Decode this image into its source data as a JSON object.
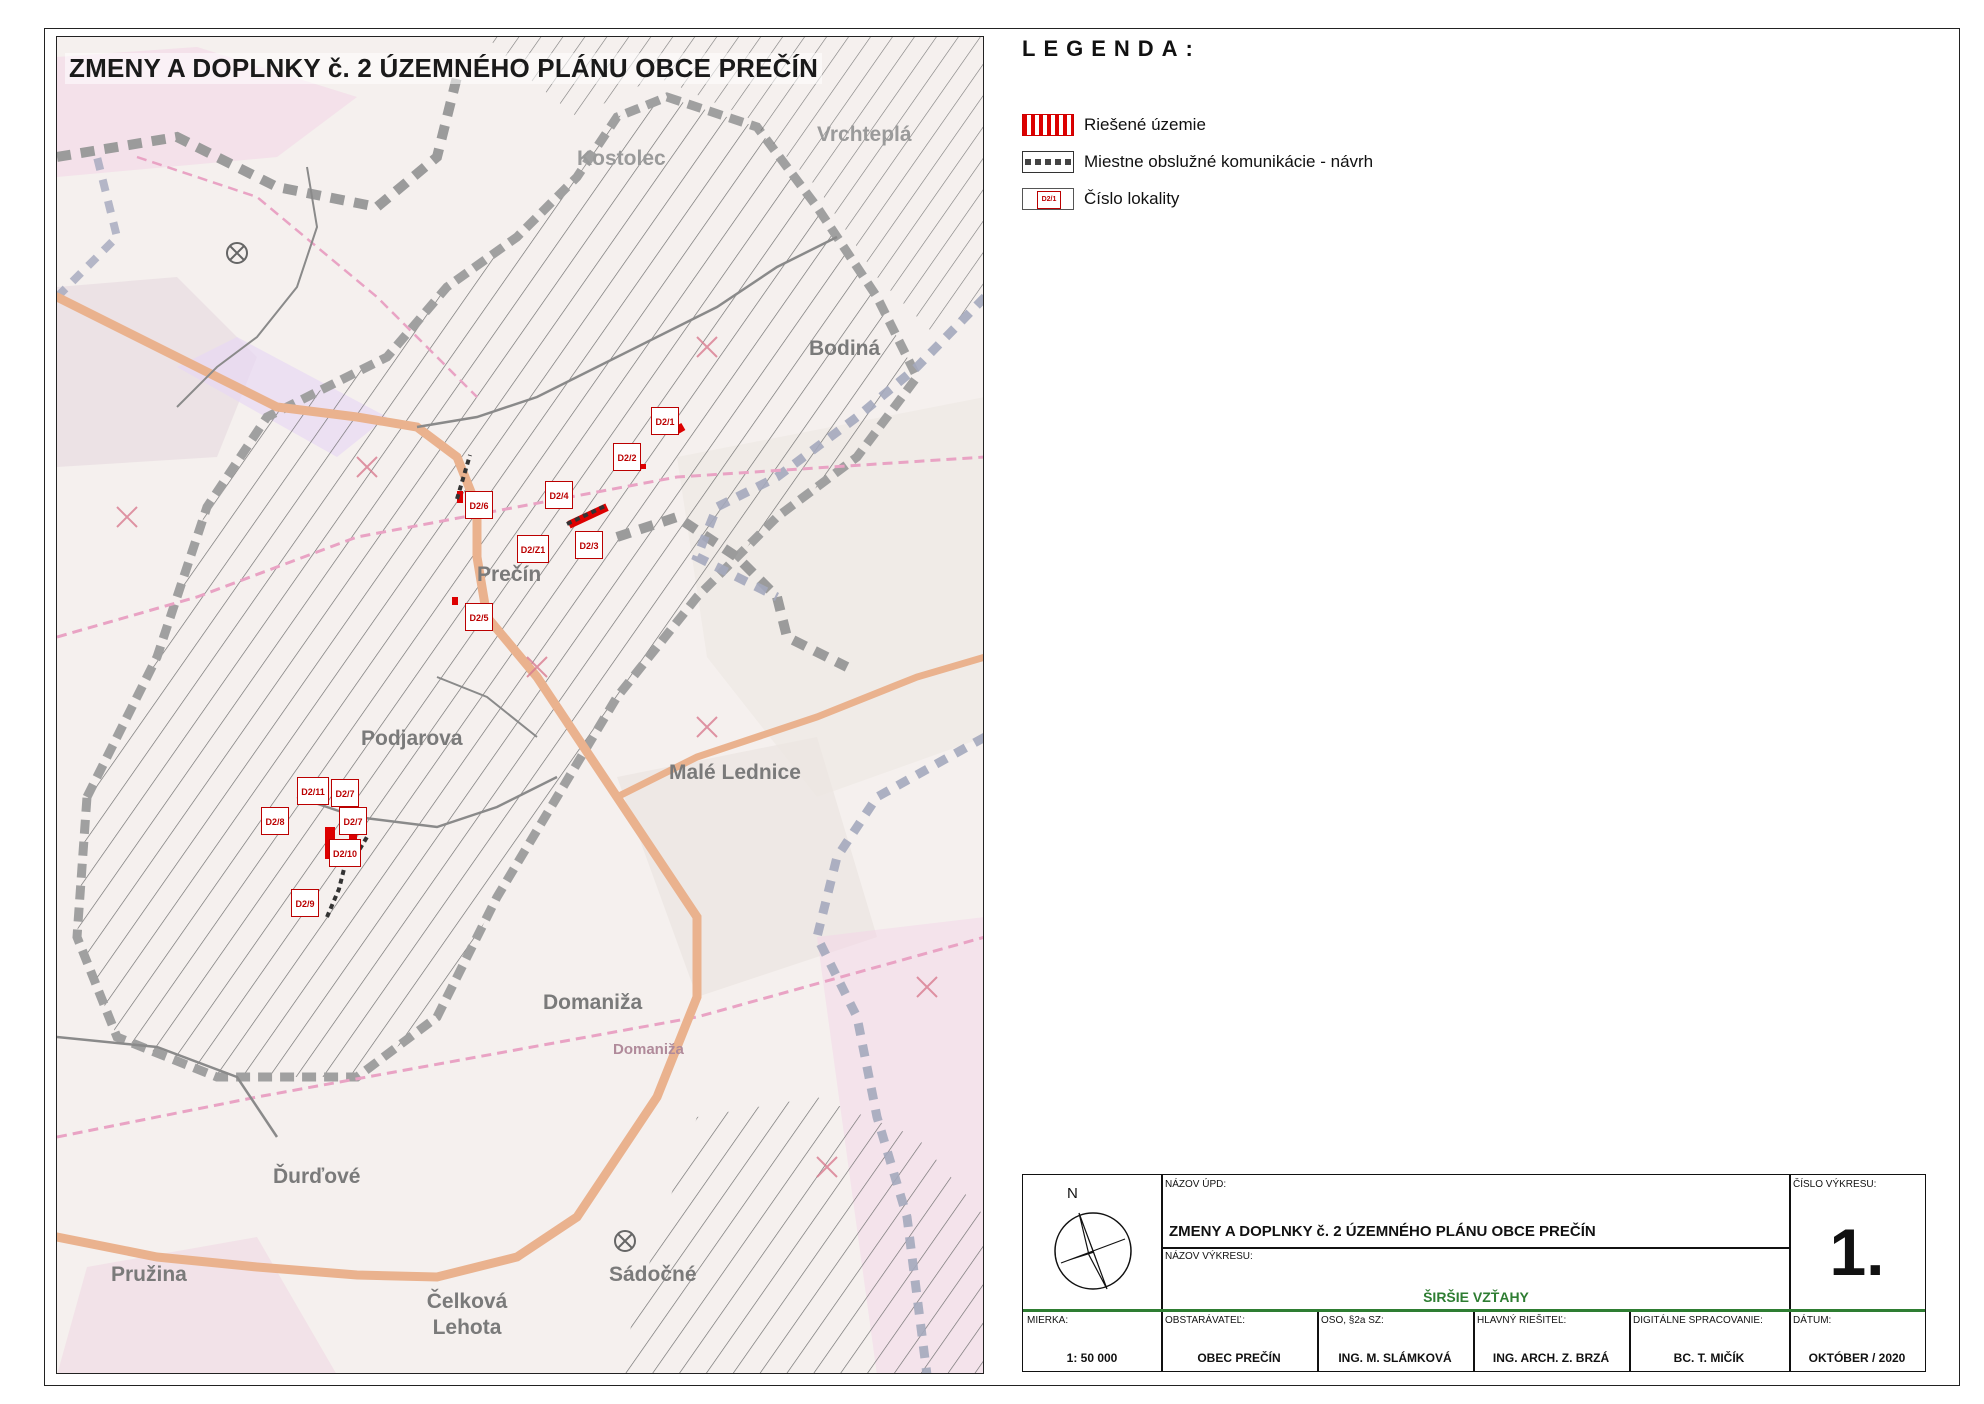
{
  "map": {
    "title": "ZMENY A DOPLNKY č. 2 ÚZEMNÉHO PLÁNU OBCE PREČÍN",
    "places": [
      {
        "name": "Prečín"
      },
      {
        "name": "Bodiná"
      },
      {
        "name": "Podjarova"
      },
      {
        "name": "Malé Lednice"
      },
      {
        "name": "Domaniža"
      },
      {
        "name": "Domaniža"
      },
      {
        "name": "Ďurďové"
      },
      {
        "name": "Pružina"
      },
      {
        "name": "Sádočné"
      },
      {
        "name": "Čelková Lehota"
      },
      {
        "name": "Kostolec"
      },
      {
        "name": "Vrchteplá"
      }
    ],
    "localities": [
      "D2/1",
      "D2/2",
      "D2/4",
      "D2/6",
      "D2/3",
      "D2/Z1",
      "D2/5",
      "D2/11",
      "D2/7",
      "D2/8",
      "D2/7",
      "D2/10",
      "D2/9"
    ]
  },
  "legend": {
    "title": "LEGENDA:",
    "items": [
      {
        "label": "Riešené územie"
      },
      {
        "label": "Miestne obslužné komunikácie - návrh"
      },
      {
        "label": "Číslo lokality",
        "symbol_text": "D2/1"
      }
    ]
  },
  "title_block": {
    "nazov_upd_label": "NÁZOV ÚPD:",
    "nazov_upd": "ZMENY A DOPLNKY č. 2 ÚZEMNÉHO PLÁNU OBCE PREČÍN",
    "nazov_vykresu_label": "NÁZOV VÝKRESU:",
    "nazov_vykresu": "ŠIRŠIE VZŤAHY",
    "cislo_label": "ČÍSLO VÝKRESU:",
    "cislo": "1.",
    "north": "N",
    "fields": [
      {
        "label": "MIERKA:",
        "value": "1: 50 000"
      },
      {
        "label": "OBSTARÁVATEĽ:",
        "value": "OBEC PREČÍN"
      },
      {
        "label": "OSO, §2a SZ:",
        "value": "ING. M. SLÁMKOVÁ"
      },
      {
        "label": "HLAVNÝ RIEŠITEĽ:",
        "value": "ING. ARCH. Z. BRZÁ"
      },
      {
        "label": "DIGITÁLNE SPRACOVANIE:",
        "value": "BC. T. MIČÍK"
      },
      {
        "label": "DÁTUM:",
        "value": "OKTÓBER / 2020"
      }
    ]
  },
  "colors": {
    "hatch": "#555555",
    "gray_boundary": "#a9a9a9",
    "orange_road": "#e8a77a",
    "pink_zone": "#f2c6e0",
    "red_area": "#dd0000",
    "title_green": "#2e7d32"
  }
}
